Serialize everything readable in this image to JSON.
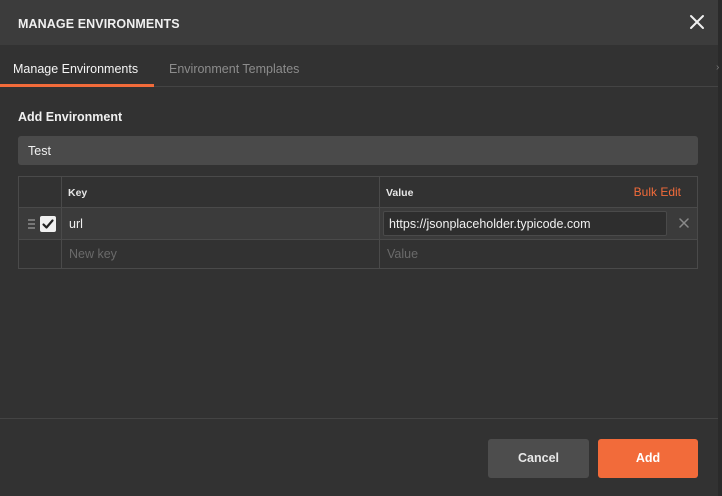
{
  "header": {
    "title": "MANAGE ENVIRONMENTS",
    "close_icon": "close-icon"
  },
  "tabs": [
    {
      "label": "Manage Environments",
      "active": true
    },
    {
      "label": "Environment Templates",
      "active": false
    }
  ],
  "form": {
    "section_title": "Add Environment",
    "environment_name": "Test",
    "table": {
      "headers": {
        "key": "Key",
        "value": "Value",
        "bulk_edit": "Bulk Edit"
      },
      "rows": [
        {
          "enabled": true,
          "key": "url",
          "value": "https://jsonplaceholder.typicode.com"
        }
      ],
      "new_row": {
        "key_placeholder": "New key",
        "value_placeholder": "Value"
      }
    }
  },
  "footer": {
    "cancel_label": "Cancel",
    "add_label": "Add"
  },
  "colors": {
    "accent": "#f26b3a",
    "background": "#323232",
    "header": "#3c3c3c"
  }
}
